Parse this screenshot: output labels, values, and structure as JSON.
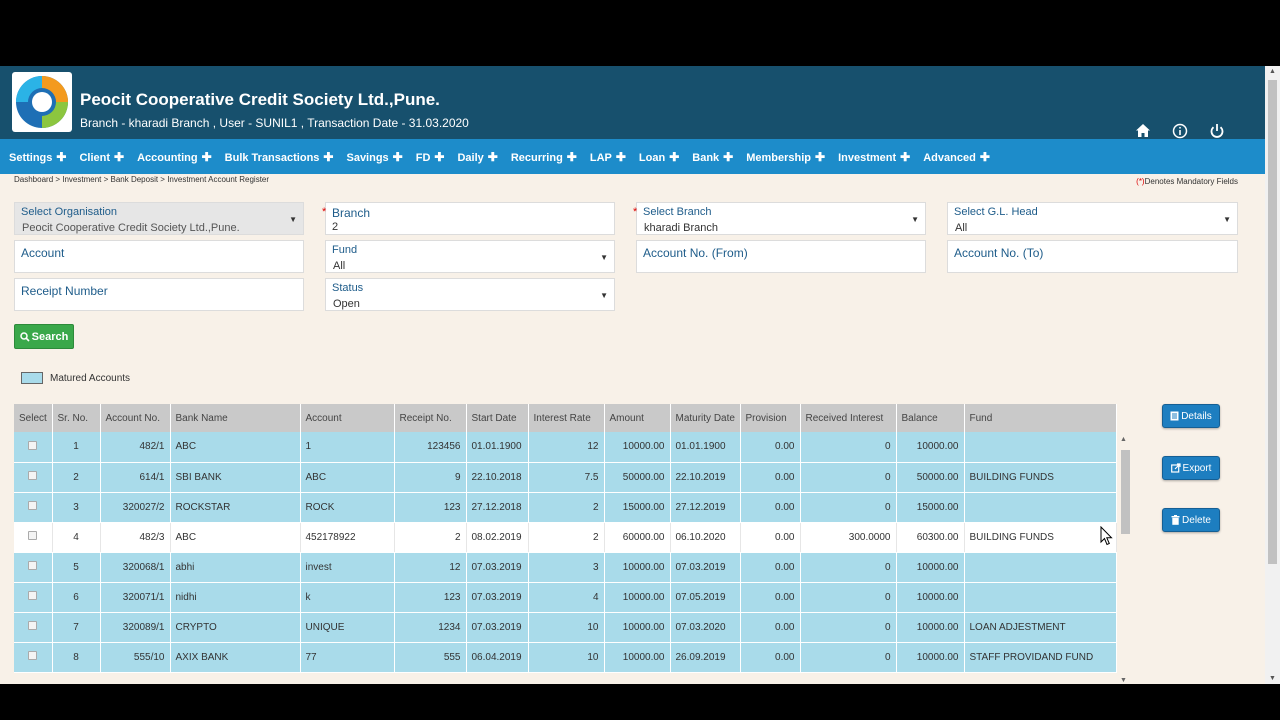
{
  "header": {
    "title": "Peocit Cooperative Credit Society Ltd.,Pune.",
    "subtitle": "Branch - kharadi Branch , User - SUNIL1 , Transaction Date - 31.03.2020",
    "icons": [
      "home-icon",
      "info-icon",
      "power-icon"
    ]
  },
  "menu": [
    {
      "label": "Settings"
    },
    {
      "label": "Client"
    },
    {
      "label": "Accounting"
    },
    {
      "label": "Bulk Transactions"
    },
    {
      "label": "Savings"
    },
    {
      "label": "FD"
    },
    {
      "label": "Daily"
    },
    {
      "label": "Recurring"
    },
    {
      "label": "LAP"
    },
    {
      "label": "Loan"
    },
    {
      "label": "Bank"
    },
    {
      "label": "Membership"
    },
    {
      "label": "Investment"
    },
    {
      "label": "Advanced"
    }
  ],
  "breadcrumb": "Dashboard > Investment > Bank Deposit > Investment Account Register",
  "mandatory": {
    "star": "(*)",
    "text": "Denotes Mandatory Fields"
  },
  "form": {
    "organisation": {
      "label": "Select Organisation",
      "value": "Peocit Cooperative Credit Society Ltd.,Pune."
    },
    "branch_code": {
      "label": "Branch",
      "value": "2"
    },
    "select_branch": {
      "label": "Select Branch",
      "value": "kharadi Branch"
    },
    "gl_head": {
      "label": "Select G.L. Head",
      "value": "All"
    },
    "account": {
      "label": "Account",
      "value": ""
    },
    "fund": {
      "label": "Fund",
      "value": "All"
    },
    "account_from": {
      "label": "Account No. (From)",
      "value": ""
    },
    "account_to": {
      "label": "Account No. (To)",
      "value": ""
    },
    "receipt_number": {
      "label": "Receipt Number",
      "value": ""
    },
    "status": {
      "label": "Status",
      "value": "Open"
    },
    "search_label": "Search"
  },
  "legend": {
    "label": "Matured Accounts",
    "color": "#a9dbea"
  },
  "table": {
    "columns": [
      "Select",
      "Sr. No.",
      "Account No.",
      "Bank Name",
      "Account",
      "Receipt No.",
      "Start Date",
      "Interest Rate",
      "Amount",
      "Maturity Date",
      "Provision",
      "Received Interest",
      "Balance",
      "Fund"
    ],
    "rows": [
      {
        "sr": "1",
        "acc_no": "482/1",
        "bank": "ABC",
        "account": "1",
        "receipt": "123456",
        "start": "01.01.1900",
        "rate": "12",
        "amount": "10000.00",
        "maturity": "01.01.1900",
        "provision": "0.00",
        "recv_int": "0",
        "balance": "10000.00",
        "fund": "",
        "matured": true
      },
      {
        "sr": "2",
        "acc_no": "614/1",
        "bank": "SBI BANK",
        "account": "ABC",
        "receipt": "9",
        "start": "22.10.2018",
        "rate": "7.5",
        "amount": "50000.00",
        "maturity": "22.10.2019",
        "provision": "0.00",
        "recv_int": "0",
        "balance": "50000.00",
        "fund": "BUILDING FUNDS",
        "matured": true
      },
      {
        "sr": "3",
        "acc_no": "320027/2",
        "bank": "ROCKSTAR",
        "account": "ROCK",
        "receipt": "123",
        "start": "27.12.2018",
        "rate": "2",
        "amount": "15000.00",
        "maturity": "27.12.2019",
        "provision": "0.00",
        "recv_int": "0",
        "balance": "15000.00",
        "fund": "",
        "matured": true
      },
      {
        "sr": "4",
        "acc_no": "482/3",
        "bank": "ABC",
        "account": "452178922",
        "receipt": "2",
        "start": "08.02.2019",
        "rate": "2",
        "amount": "60000.00",
        "maturity": "06.10.2020",
        "provision": "0.00",
        "recv_int": "300.0000",
        "balance": "60300.00",
        "fund": "BUILDING FUNDS",
        "matured": false
      },
      {
        "sr": "5",
        "acc_no": "320068/1",
        "bank": "abhi",
        "account": "invest",
        "receipt": "12",
        "start": "07.03.2019",
        "rate": "3",
        "amount": "10000.00",
        "maturity": "07.03.2019",
        "provision": "0.00",
        "recv_int": "0",
        "balance": "10000.00",
        "fund": "",
        "matured": true
      },
      {
        "sr": "6",
        "acc_no": "320071/1",
        "bank": "nidhi",
        "account": "k",
        "receipt": "123",
        "start": "07.03.2019",
        "rate": "4",
        "amount": "10000.00",
        "maturity": "07.05.2019",
        "provision": "0.00",
        "recv_int": "0",
        "balance": "10000.00",
        "fund": "",
        "matured": true
      },
      {
        "sr": "7",
        "acc_no": "320089/1",
        "bank": "CRYPTO",
        "account": "UNIQUE",
        "receipt": "1234",
        "start": "07.03.2019",
        "rate": "10",
        "amount": "10000.00",
        "maturity": "07.03.2020",
        "provision": "0.00",
        "recv_int": "0",
        "balance": "10000.00",
        "fund": "LOAN ADJESTMENT",
        "matured": true
      },
      {
        "sr": "8",
        "acc_no": "555/10",
        "bank": "AXIX BANK",
        "account": "77",
        "receipt": "555",
        "start": "06.04.2019",
        "rate": "10",
        "amount": "10000.00",
        "maturity": "26.09.2019",
        "provision": "0.00",
        "recv_int": "0",
        "balance": "10000.00",
        "fund": "STAFF PROVIDAND FUND",
        "matured": true
      }
    ]
  },
  "actions": {
    "details": "Details",
    "export": "Export",
    "delete": "Delete"
  }
}
